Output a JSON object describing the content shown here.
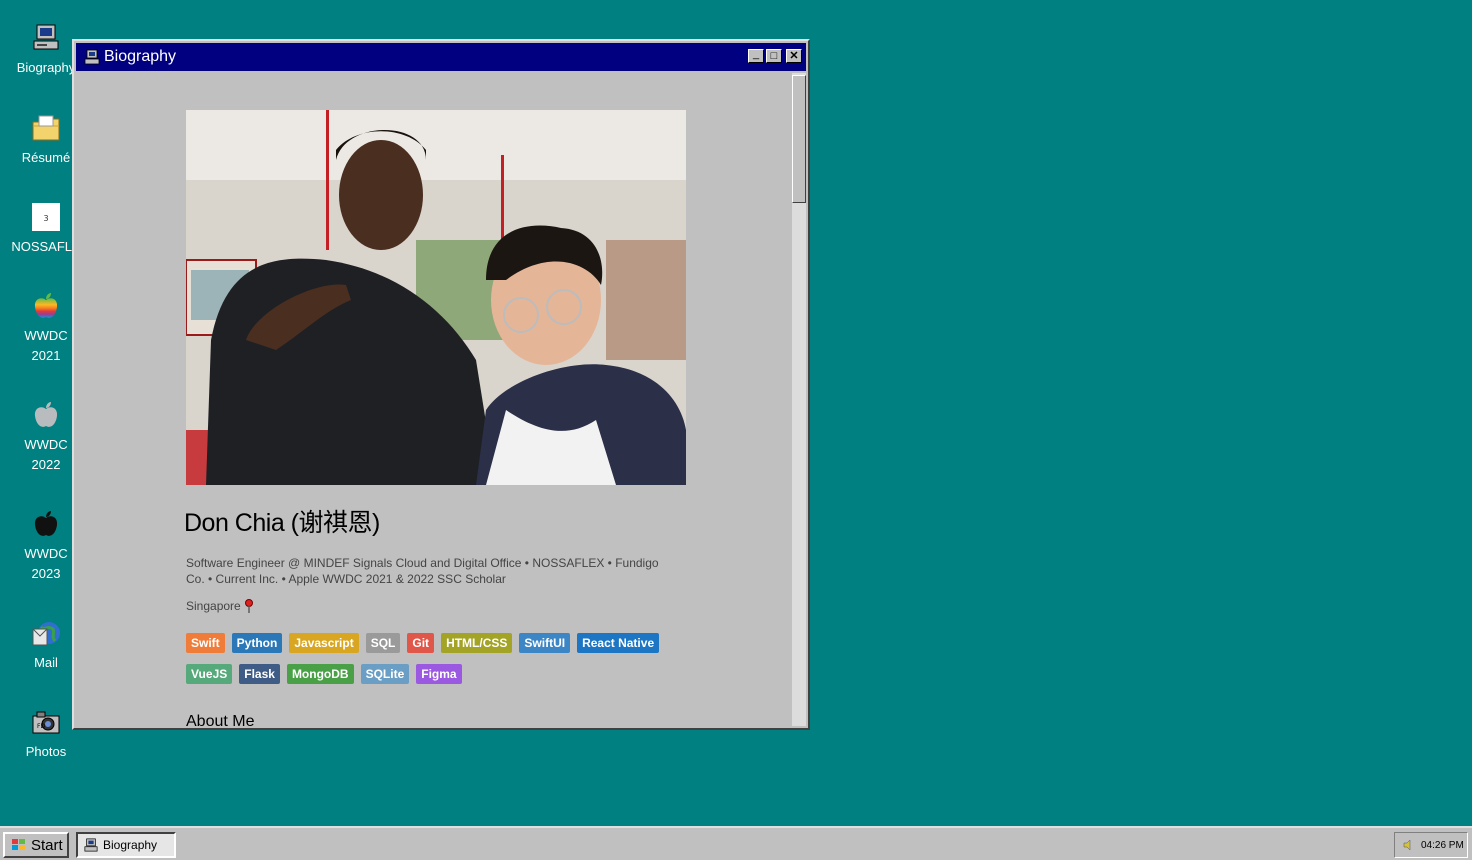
{
  "desktop": {
    "icons": [
      {
        "label": "Biography",
        "icon": "computer-icon"
      },
      {
        "label": "Résumé",
        "icon": "folder-icon"
      },
      {
        "label": "NOSSAFLE",
        "icon": "document-icon"
      },
      {
        "label": "WWDC\n2021",
        "icon": "apple-rainbow-icon"
      },
      {
        "label": "WWDC\n2022",
        "icon": "apple-gray-icon"
      },
      {
        "label": "WWDC\n2023",
        "icon": "apple-black-icon"
      },
      {
        "label": "Mail",
        "icon": "mail-icon"
      },
      {
        "label": "Photos",
        "icon": "camera-icon"
      }
    ]
  },
  "window": {
    "title": "Biography",
    "buttons": {
      "minimize": "_",
      "maximize": "□",
      "close": "✕"
    }
  },
  "profile": {
    "name": "Don Chia (谢祺恩)",
    "bio": "Software Engineer @ MINDEF Signals Cloud and Digital Office • NOSSAFLEX • Fundigo Co. • Current Inc. • Apple WWDC 2021 & 2022 SSC Scholar",
    "location": "Singapore",
    "tags_row1": [
      {
        "label": "Swift",
        "color": "#f07c3a"
      },
      {
        "label": "Python",
        "color": "#2b78b8"
      },
      {
        "label": "Javascript",
        "color": "#d8a621"
      },
      {
        "label": "SQL",
        "color": "#9a9a9a"
      },
      {
        "label": "Git",
        "color": "#e0574a"
      },
      {
        "label": "HTML/CSS",
        "color": "#a3a326"
      },
      {
        "label": "SwiftUI",
        "color": "#3d86c6"
      },
      {
        "label": "React Native",
        "color": "#1c76c4"
      }
    ],
    "tags_row2": [
      {
        "label": "VueJS",
        "color": "#55a97a"
      },
      {
        "label": "Flask",
        "color": "#3f5c86"
      },
      {
        "label": "MongoDB",
        "color": "#4aa047"
      },
      {
        "label": "SQLite",
        "color": "#6a9ec5"
      },
      {
        "label": "Figma",
        "color": "#9b58e0"
      }
    ],
    "about_heading": "About Me"
  },
  "taskbar": {
    "start_label": "Start",
    "task_label": "Biography",
    "clock": "04:26 PM"
  }
}
